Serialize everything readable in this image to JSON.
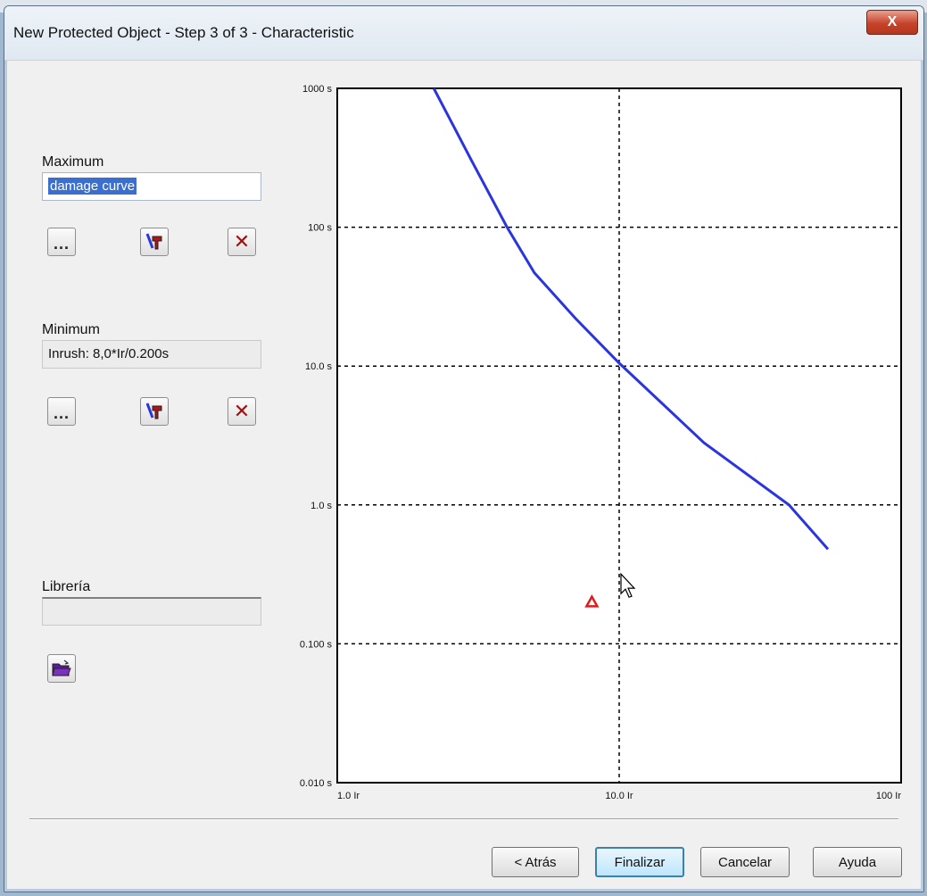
{
  "window": {
    "title": "New Protected Object - Step 3 of 3 - Characteristic",
    "close_glyph": "X"
  },
  "maximum": {
    "label": "Maximum",
    "value": "damage curve"
  },
  "minimum": {
    "label": "Minimum",
    "value": "Inrush: 8,0*Ir/0.200s"
  },
  "library": {
    "label": "Librería",
    "value": ""
  },
  "icon_buttons": {
    "browse_glyph": "...",
    "delete_glyph": "✕"
  },
  "buttons": {
    "back": "< Atrás",
    "finish": "Finalizar",
    "cancel": "Cancelar",
    "help": "Ayuda"
  },
  "colors": {
    "curve": "#2a35e0",
    "marker": "#e01a1a",
    "grid": "#000000"
  },
  "chart_data": {
    "type": "line",
    "x_scale": "log",
    "y_scale": "log",
    "xlim": [
      1,
      100
    ],
    "ylim": [
      0.01,
      1000
    ],
    "x_ticks": [
      {
        "value": 1,
        "label": "1.0 Ir"
      },
      {
        "value": 10,
        "label": "10.0 Ir"
      },
      {
        "value": 100,
        "label": "100 Ir"
      }
    ],
    "y_ticks": [
      {
        "value": 1000,
        "label": "1000 s"
      },
      {
        "value": 100,
        "label": "100 s"
      },
      {
        "value": 10,
        "label": "10.0 s"
      },
      {
        "value": 1,
        "label": "1.0 s"
      },
      {
        "value": 0.1,
        "label": "0.100 s"
      },
      {
        "value": 0.01,
        "label": "0.010 s"
      }
    ],
    "grid": "dashed at major decades",
    "series": [
      {
        "points": [
          {
            "x": 2.2,
            "y": 1000
          },
          {
            "x": 3.0,
            "y": 300
          },
          {
            "x": 4.0,
            "y": 100
          },
          {
            "x": 5.0,
            "y": 47
          },
          {
            "x": 7.0,
            "y": 22
          },
          {
            "x": 10.0,
            "y": 10.5
          },
          {
            "x": 20.0,
            "y": 2.8
          },
          {
            "x": 40.0,
            "y": 1.0
          },
          {
            "x": 55.0,
            "y": 0.48
          }
        ]
      }
    ],
    "markers": [
      {
        "x": 8.0,
        "y": 0.2,
        "shape": "triangle"
      }
    ]
  }
}
